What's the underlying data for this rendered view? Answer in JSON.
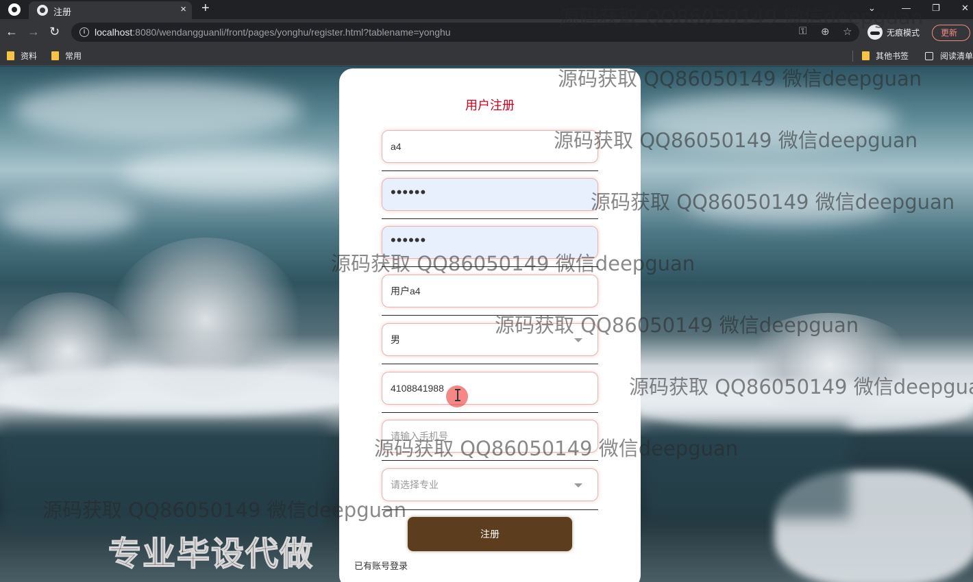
{
  "browser": {
    "tab_title": "注册",
    "tab_close": "×",
    "new_tab": "+",
    "url_host": "localhost",
    "url_rest": ":8080/wendangguanli/front/pages/yonghu/register.html?tablename=yonghu",
    "incognito_label": "无痕模式",
    "update_label": "更新",
    "bookmarks": [
      "资料",
      "常用"
    ],
    "bookmarks_right": [
      "其他书签",
      "阅读清单"
    ]
  },
  "form": {
    "title": "用户注册",
    "account_value": "a4",
    "password_value": "••••••",
    "confirm_password_value": "••••••",
    "name_value": "用户a4",
    "gender_value": "男",
    "id_card_value": "4108841988",
    "phone_placeholder": "请输入手机号",
    "major_placeholder": "请选择专业",
    "submit_label": "注册",
    "login_link": "已有账号登录"
  },
  "overlay": {
    "watermark": "源码获取 QQ86050149 微信deepguan",
    "banner": "专业毕设代做"
  },
  "colors": {
    "title": "#d0021b",
    "submit_bg": "#5c3d1e",
    "autofill_bg": "#e8f0fe"
  }
}
